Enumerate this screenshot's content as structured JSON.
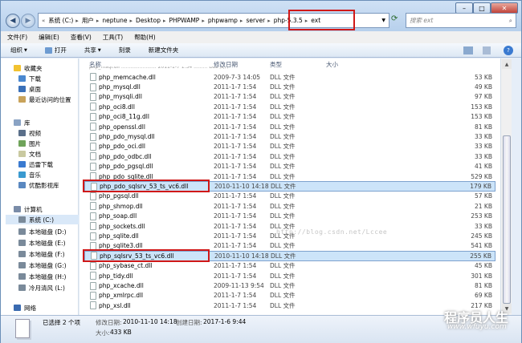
{
  "address": {
    "crumbs": [
      "系统 (C:)",
      "用户",
      "neptune",
      "Desktop",
      "PHPWAMP",
      "phpwamp",
      "server",
      "php-5.3.5",
      "ext"
    ]
  },
  "search": {
    "placeholder": "搜索 ext"
  },
  "menu": [
    "文件(F)",
    "编辑(E)",
    "查看(V)",
    "工具(T)",
    "帮助(H)"
  ],
  "toolbar": [
    "组织",
    "打开",
    "共享",
    "刻录",
    "新建文件夹"
  ],
  "nav": {
    "favorites": "收藏夹",
    "fav_items": [
      "下载",
      "桌面",
      "最近访问的位置"
    ],
    "libraries": "库",
    "lib_items": [
      "视频",
      "图片",
      "文档",
      "迅雷下载",
      "音乐",
      "优酷影视库"
    ],
    "computer": "计算机",
    "drives": [
      "系统 (C:)",
      "本地磁盘 (D:)",
      "本地磁盘 (E:)",
      "本地磁盘 (F:)",
      "本地磁盘 (G:)",
      "本地磁盘 (H:)",
      "冷月清风 (L:)"
    ],
    "network": "网络"
  },
  "columns": [
    "名称",
    "修改日期",
    "类型",
    "大小"
  ],
  "files": [
    {
      "name": "php_memcache.dll",
      "date": "2009-7-3 14:05",
      "type": "DLL 文件",
      "size": "53 KB"
    },
    {
      "name": "php_mysql.dll",
      "date": "2011-1-7 1:54",
      "type": "DLL 文件",
      "size": "49 KB"
    },
    {
      "name": "php_mysqli.dll",
      "date": "2011-1-7 1:54",
      "type": "DLL 文件",
      "size": "97 KB"
    },
    {
      "name": "php_oci8.dll",
      "date": "2011-1-7 1:54",
      "type": "DLL 文件",
      "size": "153 KB"
    },
    {
      "name": "php_oci8_11g.dll",
      "date": "2011-1-7 1:54",
      "type": "DLL 文件",
      "size": "153 KB"
    },
    {
      "name": "php_openssl.dll",
      "date": "2011-1-7 1:54",
      "type": "DLL 文件",
      "size": "81 KB"
    },
    {
      "name": "php_pdo_mysql.dll",
      "date": "2011-1-7 1:54",
      "type": "DLL 文件",
      "size": "33 KB"
    },
    {
      "name": "php_pdo_oci.dll",
      "date": "2011-1-7 1:54",
      "type": "DLL 文件",
      "size": "33 KB"
    },
    {
      "name": "php_pdo_odbc.dll",
      "date": "2011-1-7 1:54",
      "type": "DLL 文件",
      "size": "33 KB"
    },
    {
      "name": "php_pdo_pgsql.dll",
      "date": "2011-1-7 1:54",
      "type": "DLL 文件",
      "size": "41 KB"
    },
    {
      "name": "php_pdo_sqlite.dll",
      "date": "2011-1-7 1:54",
      "type": "DLL 文件",
      "size": "529 KB"
    },
    {
      "name": "php_pdo_sqlsrv_53_ts_vc6.dll",
      "date": "2010-11-10 14:18",
      "type": "DLL 文件",
      "size": "179 KB",
      "selected": true
    },
    {
      "name": "php_pgsql.dll",
      "date": "2011-1-7 1:54",
      "type": "DLL 文件",
      "size": "57 KB"
    },
    {
      "name": "php_shmop.dll",
      "date": "2011-1-7 1:54",
      "type": "DLL 文件",
      "size": "21 KB"
    },
    {
      "name": "php_soap.dll",
      "date": "2011-1-7 1:54",
      "type": "DLL 文件",
      "size": "253 KB"
    },
    {
      "name": "php_sockets.dll",
      "date": "2011-1-7 1:54",
      "type": "DLL 文件",
      "size": "33 KB"
    },
    {
      "name": "php_sqlite.dll",
      "date": "2011-1-7 1:54",
      "type": "DLL 文件",
      "size": "245 KB"
    },
    {
      "name": "php_sqlite3.dll",
      "date": "2011-1-7 1:54",
      "type": "DLL 文件",
      "size": "541 KB"
    },
    {
      "name": "php_sqlsrv_53_ts_vc6.dll",
      "date": "2010-11-10 14:18",
      "type": "DLL 文件",
      "size": "255 KB",
      "selected": true
    },
    {
      "name": "php_sybase_ct.dll",
      "date": "2011-1-7 1:54",
      "type": "DLL 文件",
      "size": "45 KB"
    },
    {
      "name": "php_tidy.dll",
      "date": "2011-1-7 1:54",
      "type": "DLL 文件",
      "size": "301 KB"
    },
    {
      "name": "php_xcache.dll",
      "date": "2009-11-13 9:54",
      "type": "DLL 文件",
      "size": "81 KB"
    },
    {
      "name": "php_xmlrpc.dll",
      "date": "2011-1-7 1:54",
      "type": "DLL 文件",
      "size": "69 KB"
    },
    {
      "name": "php_xsl.dll",
      "date": "2011-1-7 1:54",
      "type": "DLL 文件",
      "size": "217 KB"
    }
  ],
  "watermark": "http://blog.csdn.net/Lccee",
  "status": {
    "selected": "已选择 2 个项",
    "modified_label": "修改日期:",
    "modified": "2010-11-10 14:18",
    "created_label": "创建日期:",
    "created": "2017-1-6 9:44",
    "size_label": "大小:",
    "size": "433 KB"
  },
  "brand": {
    "title": "程序员人生",
    "url": "www.wfuyu.com"
  },
  "colors": {
    "accent": "#d01818",
    "selection": "#cce4f9"
  }
}
